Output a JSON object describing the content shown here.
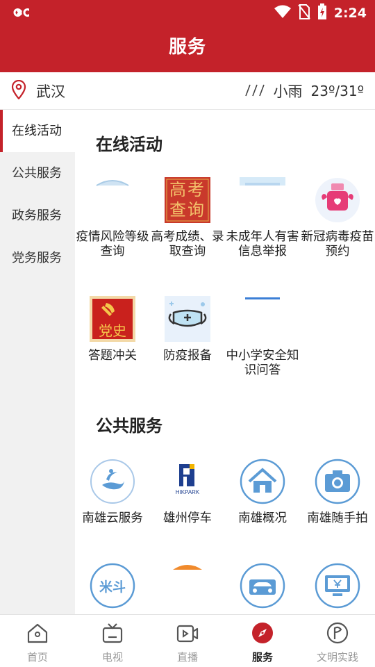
{
  "status_bar": {
    "time": "2:24"
  },
  "header": {
    "title": "服务"
  },
  "location": {
    "city": "武汉",
    "weather": "小雨",
    "temperature": "23º/31º"
  },
  "sidebar": {
    "items": [
      {
        "label": "在线活动",
        "active": true
      },
      {
        "label": "公共服务",
        "active": false
      },
      {
        "label": "政务服务",
        "active": false
      },
      {
        "label": "党务服务",
        "active": false
      }
    ]
  },
  "sections": [
    {
      "title": "在线活动",
      "items": [
        {
          "label": "疫情风险等级查询",
          "icon": "partial-banner-icon"
        },
        {
          "label": "高考成绩、录取查询",
          "icon": "gaokao-query-icon",
          "icon_text": "高考查询"
        },
        {
          "label": "未成年人有害信息举报",
          "icon": "partial-banner-icon"
        },
        {
          "label": "新冠病毒疫苗预约",
          "icon": "vaccine-booking-icon"
        },
        {
          "label": "答题冲关",
          "icon": "party-history-icon",
          "icon_text": "党史"
        },
        {
          "label": "防疫报备",
          "icon": "mask-icon"
        },
        {
          "label": "中小学安全知识问答",
          "icon": "partial-banner-icon"
        }
      ]
    },
    {
      "title": "公共服务",
      "items": [
        {
          "label": "南雄云服务",
          "icon": "cloud-service-icon"
        },
        {
          "label": "雄州停车",
          "icon": "hikpark-icon",
          "icon_text": "HIKPARK"
        },
        {
          "label": "南雄概况",
          "icon": "home-icon"
        },
        {
          "label": "南雄随手拍",
          "icon": "camera-icon"
        },
        {
          "label": "",
          "icon": "rice-icon",
          "icon_text": "米斗"
        },
        {
          "label": "",
          "icon": "umbrella-icon"
        },
        {
          "label": "",
          "icon": "car-icon"
        },
        {
          "label": "",
          "icon": "monitor-icon"
        }
      ]
    }
  ],
  "bottom_nav": {
    "items": [
      {
        "label": "首页",
        "icon": "home-icon",
        "active": false
      },
      {
        "label": "电视",
        "icon": "tv-icon",
        "active": false
      },
      {
        "label": "直播",
        "icon": "live-video-icon",
        "active": false
      },
      {
        "label": "服务",
        "icon": "compass-icon",
        "active": true
      },
      {
        "label": "文明实践",
        "icon": "flag-icon",
        "active": false
      }
    ]
  },
  "colors": {
    "brand_red": "#c4222a",
    "icon_blue": "#5b9bd5",
    "sidebar_bg": "#f1f1f1"
  }
}
